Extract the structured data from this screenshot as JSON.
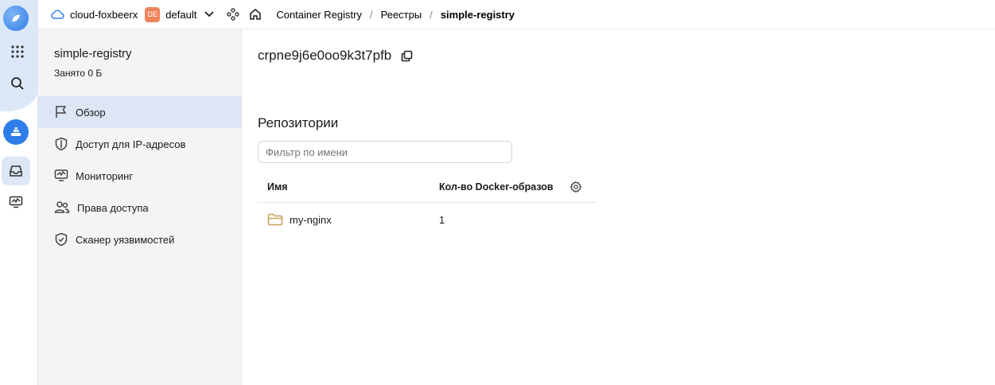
{
  "header": {
    "cloud_name": "cloud-foxbeerx",
    "folder_badge": "DE",
    "folder_name": "default",
    "breadcrumbs": [
      "Container Registry",
      "Реестры",
      "simple-registry"
    ],
    "separator": "/"
  },
  "sidebar": {
    "title": "simple-registry",
    "subtitle": "Занято 0 Б",
    "items": [
      {
        "label": "Обзор",
        "icon": "flag-icon",
        "active": true
      },
      {
        "label": "Доступ для IP-адресов",
        "icon": "shield-icon",
        "active": false
      },
      {
        "label": "Мониторинг",
        "icon": "monitor-icon",
        "active": false
      },
      {
        "label": "Права доступа",
        "icon": "users-icon",
        "active": false
      },
      {
        "label": "Сканер уязвимостей",
        "icon": "shield-check-icon",
        "active": false
      }
    ]
  },
  "main": {
    "registry_id": "crpne9j6e0oo9k3t7pfb",
    "section_title": "Репозитории",
    "filter_placeholder": "Фильтр по имени",
    "columns": [
      "Имя",
      "Кол-во Docker-образов"
    ],
    "rows": [
      {
        "name": "my-nginx",
        "count": "1"
      }
    ]
  },
  "colors": {
    "accent": "#2f7de8",
    "active_bg": "#dce6f5",
    "badge": "#f0845a",
    "folder": "#c9a15a"
  }
}
